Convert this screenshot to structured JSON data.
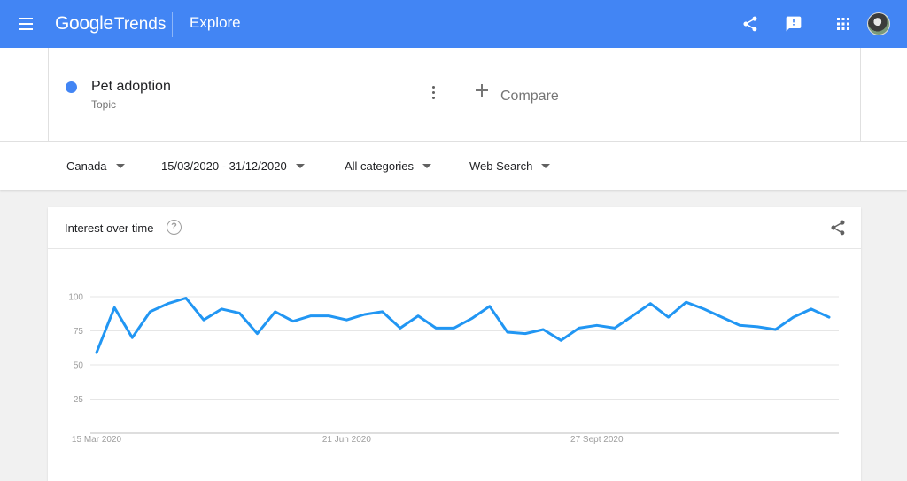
{
  "header": {
    "logo_google": "Google",
    "logo_trends": "Trends",
    "section": "Explore",
    "icons": [
      "menu-icon",
      "share-icon",
      "feedback-icon",
      "apps-icon"
    ],
    "brand_color": "#4285f4"
  },
  "search": {
    "term": {
      "name": "Pet adoption",
      "type": "Topic",
      "color": "#4285f4"
    },
    "compare_label": "Compare"
  },
  "filters": {
    "region": "Canada",
    "date_range": "15/03/2020 - 31/12/2020",
    "category": "All categories",
    "search_type": "Web Search"
  },
  "card": {
    "title": "Interest over time"
  },
  "chart_data": {
    "type": "line",
    "title": "",
    "xlabel": "",
    "ylabel": "",
    "ylim": [
      0,
      100
    ],
    "yticks": [
      25,
      50,
      75,
      100
    ],
    "x_tick_labels": [
      {
        "label": "15 Mar 2020",
        "index": 0
      },
      {
        "label": "21 Jun 2020",
        "index": 14
      },
      {
        "label": "27 Sept 2020",
        "index": 28
      }
    ],
    "grid": true,
    "line_color": "#2196f3",
    "series": [
      {
        "values": [
          59,
          92,
          70,
          89,
          95,
          99,
          83,
          91,
          88,
          73,
          89,
          82,
          86,
          86,
          83,
          87,
          89,
          77,
          86,
          77,
          77,
          84,
          93,
          74,
          73,
          76,
          68,
          77,
          79,
          77,
          86,
          95,
          85,
          96,
          91,
          85,
          79,
          78,
          76,
          85,
          91,
          85
        ]
      }
    ]
  }
}
